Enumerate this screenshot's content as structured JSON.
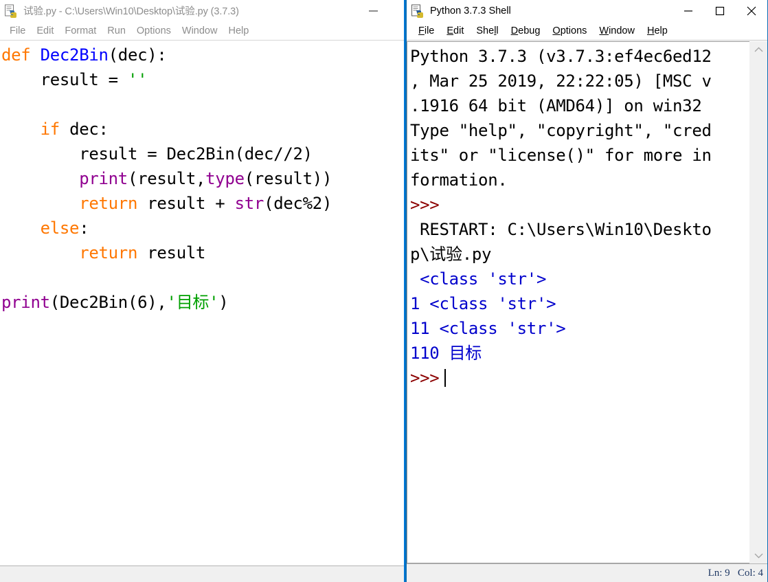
{
  "editor_window": {
    "title": "试验.py - C:\\Users\\Win10\\Desktop\\试验.py (3.7.3)",
    "icon": "python-idle-icon",
    "minimize_label": "—",
    "menu": [
      {
        "label": "File"
      },
      {
        "label": "Edit"
      },
      {
        "label": "Format"
      },
      {
        "label": "Run"
      },
      {
        "label": "Options"
      },
      {
        "label": "Window"
      },
      {
        "label": "Help"
      }
    ],
    "code_lines": [
      [
        {
          "t": "def",
          "c": "kw"
        },
        {
          "t": " ",
          "c": "plain"
        },
        {
          "t": "Dec2Bin",
          "c": "fnname"
        },
        {
          "t": "(dec):",
          "c": "plain"
        }
      ],
      [
        {
          "t": "    result = ",
          "c": "plain"
        },
        {
          "t": "''",
          "c": "str"
        }
      ],
      [],
      [
        {
          "t": "    ",
          "c": "plain"
        },
        {
          "t": "if",
          "c": "kw"
        },
        {
          "t": " dec:",
          "c": "plain"
        }
      ],
      [
        {
          "t": "        result = Dec2Bin(dec//2)",
          "c": "plain"
        }
      ],
      [
        {
          "t": "        ",
          "c": "plain"
        },
        {
          "t": "print",
          "c": "builtin"
        },
        {
          "t": "(result,",
          "c": "plain"
        },
        {
          "t": "type",
          "c": "builtin"
        },
        {
          "t": "(result))",
          "c": "plain"
        }
      ],
      [
        {
          "t": "        ",
          "c": "plain"
        },
        {
          "t": "return",
          "c": "kw"
        },
        {
          "t": " result + ",
          "c": "plain"
        },
        {
          "t": "str",
          "c": "builtin"
        },
        {
          "t": "(dec%2)",
          "c": "plain"
        }
      ],
      [
        {
          "t": "    ",
          "c": "plain"
        },
        {
          "t": "else",
          "c": "kw"
        },
        {
          "t": ":",
          "c": "plain"
        }
      ],
      [
        {
          "t": "        ",
          "c": "plain"
        },
        {
          "t": "return",
          "c": "kw"
        },
        {
          "t": " result",
          "c": "plain"
        }
      ],
      [],
      [
        {
          "t": "print",
          "c": "builtin"
        },
        {
          "t": "(Dec2Bin(6),",
          "c": "plain"
        },
        {
          "t": "'目标'",
          "c": "str"
        },
        {
          "t": ")",
          "c": "plain"
        }
      ]
    ]
  },
  "shell_window": {
    "title": "Python 3.7.3 Shell",
    "icon": "python-idle-icon",
    "window_controls": [
      {
        "name": "minimize-button",
        "label": "—"
      },
      {
        "name": "maximize-button",
        "label": "□"
      },
      {
        "name": "close-button",
        "label": "✕"
      }
    ],
    "menu": [
      {
        "label": "File",
        "accel": "F"
      },
      {
        "label": "Edit",
        "accel": "E"
      },
      {
        "label": "Shell",
        "accel": "l"
      },
      {
        "label": "Debug",
        "accel": "D"
      },
      {
        "label": "Options",
        "accel": "O"
      },
      {
        "label": "Window",
        "accel": "W"
      },
      {
        "label": "Help",
        "accel": "H"
      }
    ],
    "output_lines": [
      {
        "text": "Python 3.7.3 (v3.7.3:ef4ec6ed12",
        "style": "normal"
      },
      {
        "text": ", Mar 25 2019, 22:22:05) [MSC v",
        "style": "normal"
      },
      {
        "text": ".1916 64 bit (AMD64)] on win32",
        "style": "normal"
      },
      {
        "text": "Type \"help\", \"copyright\", \"cred",
        "style": "normal"
      },
      {
        "text": "its\" or \"license()\" for more in",
        "style": "normal"
      },
      {
        "text": "formation.",
        "style": "normal"
      },
      {
        "text": ">>>",
        "style": "prompt"
      },
      {
        "text": " RESTART: C:\\Users\\Win10\\Deskto",
        "style": "normal"
      },
      {
        "text": "p\\试验.py",
        "style": "normal"
      },
      {
        "text": " <class 'str'>",
        "style": "output"
      },
      {
        "text": "1 <class 'str'>",
        "style": "output"
      },
      {
        "text": "11 <class 'str'>",
        "style": "output"
      },
      {
        "text": "110 目标",
        "style": "output"
      },
      {
        "text": ">>>",
        "style": "prompt",
        "caret": true
      }
    ],
    "scrollbar": {
      "up_arrow": "⌃",
      "down_arrow": "⌄"
    },
    "status_bar": {
      "text": "Ln: 9   Col: 4"
    }
  },
  "colors": {
    "keyword": "#ff7700",
    "function_name": "#0000ff",
    "builtin": "#900090",
    "string": "#00a000",
    "prompt": "#8b0000",
    "shell_output": "#0000cc",
    "active_border": "#0a6cb4",
    "status_text": "#1f3864"
  }
}
